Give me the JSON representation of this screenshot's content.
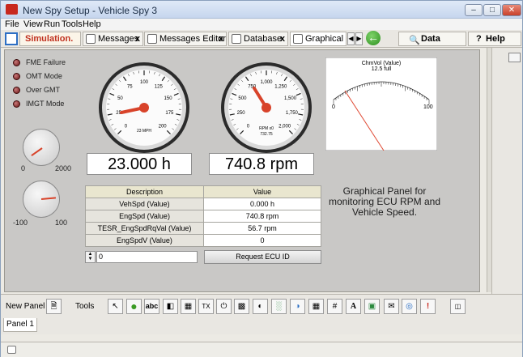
{
  "window": {
    "title": "New Spy Setup - Vehicle Spy 3"
  },
  "menu": [
    "File",
    "View",
    "Run",
    "Tools",
    "Help"
  ],
  "tabs": [
    {
      "label": "Simulation."
    },
    {
      "label": "Messages"
    },
    {
      "label": "Messages Editor"
    },
    {
      "label": "Database"
    },
    {
      "label": "Graphical P..."
    }
  ],
  "toolbar": {
    "data_label": "Data",
    "help_label": "Help"
  },
  "leds": [
    {
      "label": "FME Failure"
    },
    {
      "label": "OMT Mode"
    },
    {
      "label": "Over GMT"
    },
    {
      "label": "IMGT Mode"
    }
  ],
  "knob1": {
    "min": "0",
    "max": "2000"
  },
  "knob2": {
    "min": "-100",
    "max": "100"
  },
  "speed_gauge": {
    "unit_label": "23 MPH",
    "ticks": [
      "0",
      "25",
      "50",
      "75",
      "100",
      "125",
      "150",
      "175",
      "200"
    ],
    "readout": "23.000 h"
  },
  "rpm_gauge": {
    "unit_label": "RPM x0",
    "sub_value": "732.75",
    "ticks": [
      "0",
      "250",
      "500",
      "750",
      "1,000",
      "1,250",
      "1,500",
      "1,750",
      "2,000"
    ],
    "readout": "740.8 rpm"
  },
  "meter": {
    "title": "ChmVol (Value)",
    "subtitle": "12.5 full",
    "min_label": "0",
    "max_label": "100"
  },
  "table": {
    "headers": [
      "Description",
      "Value"
    ],
    "rows": [
      {
        "desc": "VehSpd (Value)",
        "value": "0.000 h"
      },
      {
        "desc": "EngSpd (Value)",
        "value": "740.8 rpm"
      },
      {
        "desc": "TESR_EngSpdRqVal (Value)",
        "value": "56.7 rpm"
      },
      {
        "desc": "EngSpdV (Value)",
        "value": "0"
      }
    ]
  },
  "info_text": "Graphical Panel for monitoring ECU RPM and Vehicle Speed.",
  "spinner": {
    "value": "0"
  },
  "request_button": "Request ECU ID",
  "bottom": {
    "new_panel": "New Panel",
    "tools": "Tools"
  },
  "panel_tab": "Panel 1",
  "colors": {
    "needle": "#d8432a",
    "panel_bg": "#c9c8c6",
    "header_bg": "#e9e6cf"
  }
}
